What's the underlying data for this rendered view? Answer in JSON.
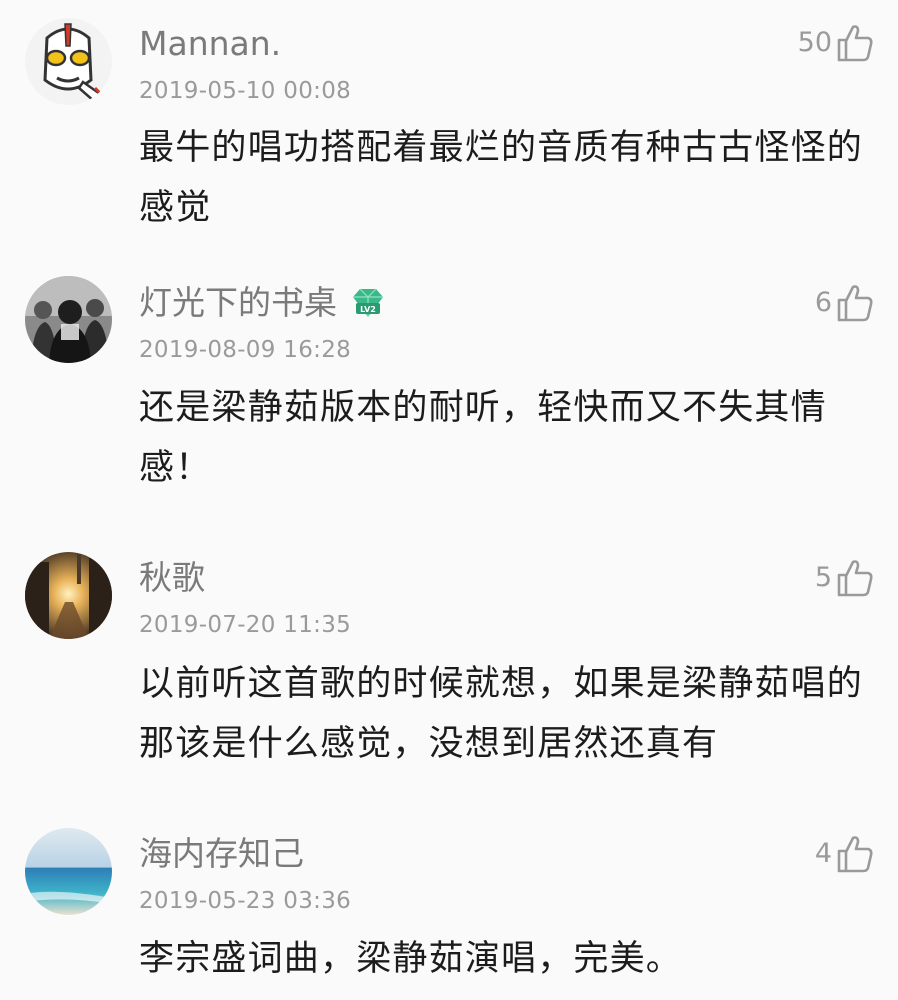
{
  "comments": [
    {
      "username": "Mannan.",
      "timestamp": "2019-05-10 00:08",
      "likes": "50",
      "content": "最牛的唱功搭配着最烂的音质有种古古怪怪的感觉",
      "avatar_icon": "ultraman-avatar-icon"
    },
    {
      "username": "灯光下的书桌",
      "badge": "LV2",
      "timestamp": "2019-08-09 16:28",
      "likes": "6",
      "content": "还是梁静茹版本的耐听，轻快而又不失其情感！",
      "avatar_icon": "group-photo-avatar-icon"
    },
    {
      "username": "秋歌",
      "timestamp": "2019-07-20 11:35",
      "likes": "5",
      "content": "以前听这首歌的时候就想，如果是梁静茹唱的那该是什么感觉，没想到居然还真有",
      "avatar_icon": "sunset-street-avatar-icon"
    },
    {
      "username": "海内存知己",
      "timestamp": "2019-05-23 03:36",
      "likes": "4",
      "content": "李宗盛词曲，梁静茹演唱，完美。",
      "avatar_icon": "ocean-avatar-icon"
    }
  ],
  "colors": {
    "background": "#fafafa",
    "username": "#7a7a7a",
    "meta": "#9a9a9a",
    "content": "#1c1c1c",
    "badge": "#3bb88a"
  }
}
